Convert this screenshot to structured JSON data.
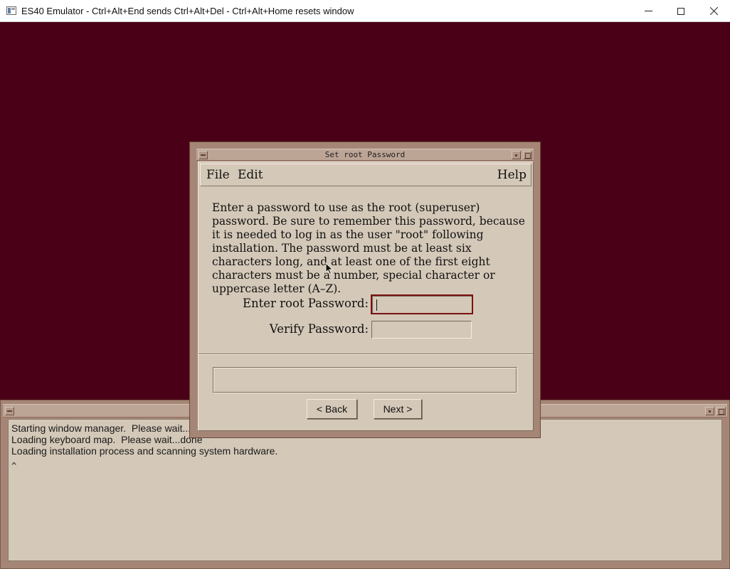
{
  "host_window": {
    "title": "ES40 Emulator - Ctrl+Alt+End sends Ctrl+Alt+Del - Ctrl+Alt+Home resets window",
    "icon": "app-window-icon",
    "controls": [
      "minimize-icon",
      "maximize-icon",
      "close-icon"
    ]
  },
  "dialog": {
    "title": "Set root Password",
    "menu": {
      "file": "File",
      "edit": "Edit",
      "help": "Help"
    },
    "instructions": "Enter a password to use as the root (superuser) password. Be sure to remember this password, because it is needed to log in as the user \"root\" following installation.  The password must be at least six characters long, and at least one of the first eight characters must be a number, special character or uppercase letter (A–Z).",
    "fields": {
      "password_label": "Enter root Password:",
      "password_value": "",
      "verify_label": "Verify Password:",
      "verify_value": ""
    },
    "status_message": "",
    "buttons": {
      "back": "< Back",
      "next": "Next >"
    }
  },
  "console": {
    "lines": [
      "Starting window manager.  Please wait...",
      "Loading keyboard map.  Please wait...done",
      "Loading installation process and scanning system hardware."
    ],
    "prompt": "^"
  },
  "colors": {
    "desktop_background": "#4a0016",
    "window_frame": "#a58676",
    "dialog_background": "#d4c8b8",
    "focus_border": "#7a1010"
  }
}
